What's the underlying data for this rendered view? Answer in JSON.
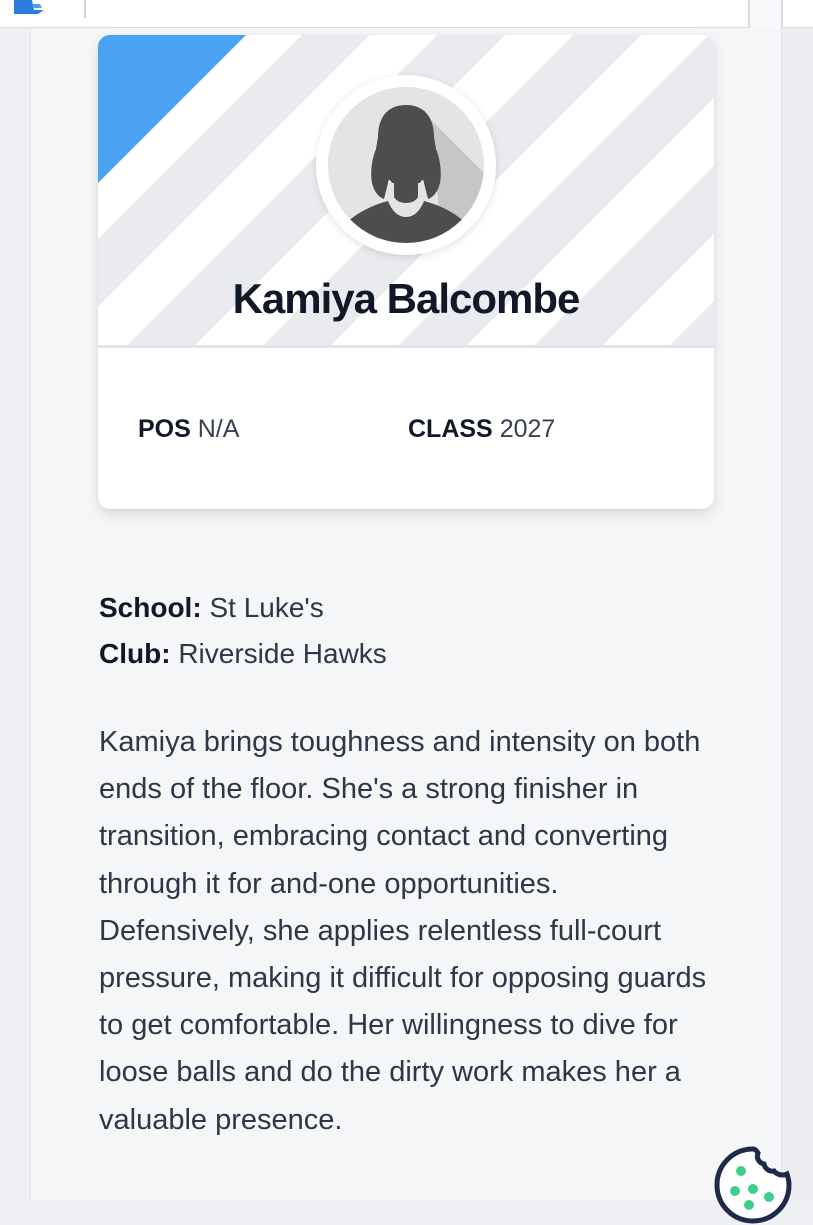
{
  "player": {
    "name": "Kamiya Balcombe",
    "pos_label": "POS",
    "pos_value": "N/A",
    "class_label": "CLASS",
    "class_value": "2027"
  },
  "details": {
    "school_label": "School:",
    "school_value": "St Luke's",
    "club_label": "Club:",
    "club_value": "Riverside Hawks"
  },
  "bio": "Kamiya brings toughness and intensity on both ends of the floor. She's a strong finisher in transition, embracing contact and converting through it for and-one opportunities. Defensively, she applies relentless full-court pressure, making it difficult for opposing guards to get comfortable. Her willingness to dive for loose balls and do the dirty work makes her a valuable presence.",
  "icons": {
    "logo": "site-logo-icon",
    "avatar": "default-avatar-silhouette",
    "cookie": "cookie-icon"
  },
  "colors": {
    "accent_blue": "#4aa3f2",
    "cookie_green": "#3ecf8e",
    "cookie_outline": "#1e2a4a"
  }
}
